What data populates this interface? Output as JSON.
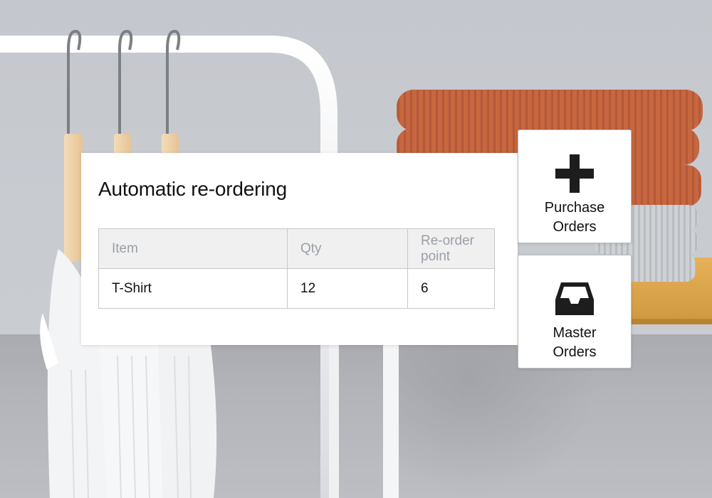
{
  "card": {
    "title": "Automatic re-ordering",
    "table": {
      "headers": [
        "Item",
        "Qty",
        "Re-order point"
      ],
      "rows": [
        [
          "T-Shirt",
          "12",
          "6"
        ]
      ]
    }
  },
  "actions": {
    "purchase_orders": {
      "label": "Purchase\nOrders",
      "icon": "plus-icon"
    },
    "master_orders": {
      "label": "Master\nOrders",
      "icon": "inbox-tray-icon"
    }
  },
  "colors": {
    "header_text": "#9a9fa7",
    "header_bg": "#f0f0f0",
    "table_border": "#c8c8c8",
    "icon": "#1d1d1d",
    "sweater": "#c7673f"
  }
}
